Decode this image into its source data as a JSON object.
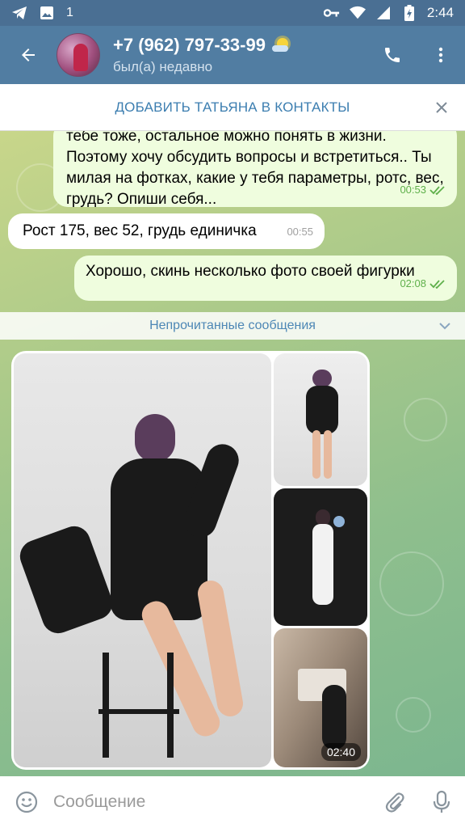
{
  "status_bar": {
    "time": "2:44",
    "notification_count": "1",
    "icons": [
      "telegram-icon",
      "image-icon",
      "key-icon",
      "wifi-icon",
      "signal-icon",
      "battery-icon"
    ]
  },
  "header": {
    "contact_name": "+7 (962) 797-33-99",
    "status": "был(а) недавно",
    "icons": [
      "back-arrow-icon",
      "phone-icon",
      "more-vert-icon"
    ]
  },
  "add_contact": {
    "label": "ДОБАВИТЬ ТАТЬЯНА В КОНТАКТЫ"
  },
  "messages": [
    {
      "direction": "out",
      "text": "тебе тоже, остальное можно понять в жизни. Поэтому хочу обсудить вопросы и встретиться.. Ты милая на фотках, какие у тебя параметры, ротс, вес, грудь? Опиши себя...",
      "time": "00:53",
      "read": true
    },
    {
      "direction": "in",
      "text": "Рост 175, вес 52, грудь единичка",
      "time": "00:55"
    },
    {
      "direction": "out",
      "text": "Хорошо, скинь несколько фото своей фигурки",
      "time": "02:08",
      "read": true
    }
  ],
  "unread_divider": {
    "label": "Непрочитанные сообщения"
  },
  "album": {
    "time": "02:40"
  },
  "composer": {
    "placeholder": "Сообщение"
  },
  "colors": {
    "header": "#517da2",
    "outgoing_bubble": "#effdde",
    "incoming_bubble": "#ffffff",
    "accent": "#3c7eb0",
    "read_check": "#5fb04b"
  }
}
